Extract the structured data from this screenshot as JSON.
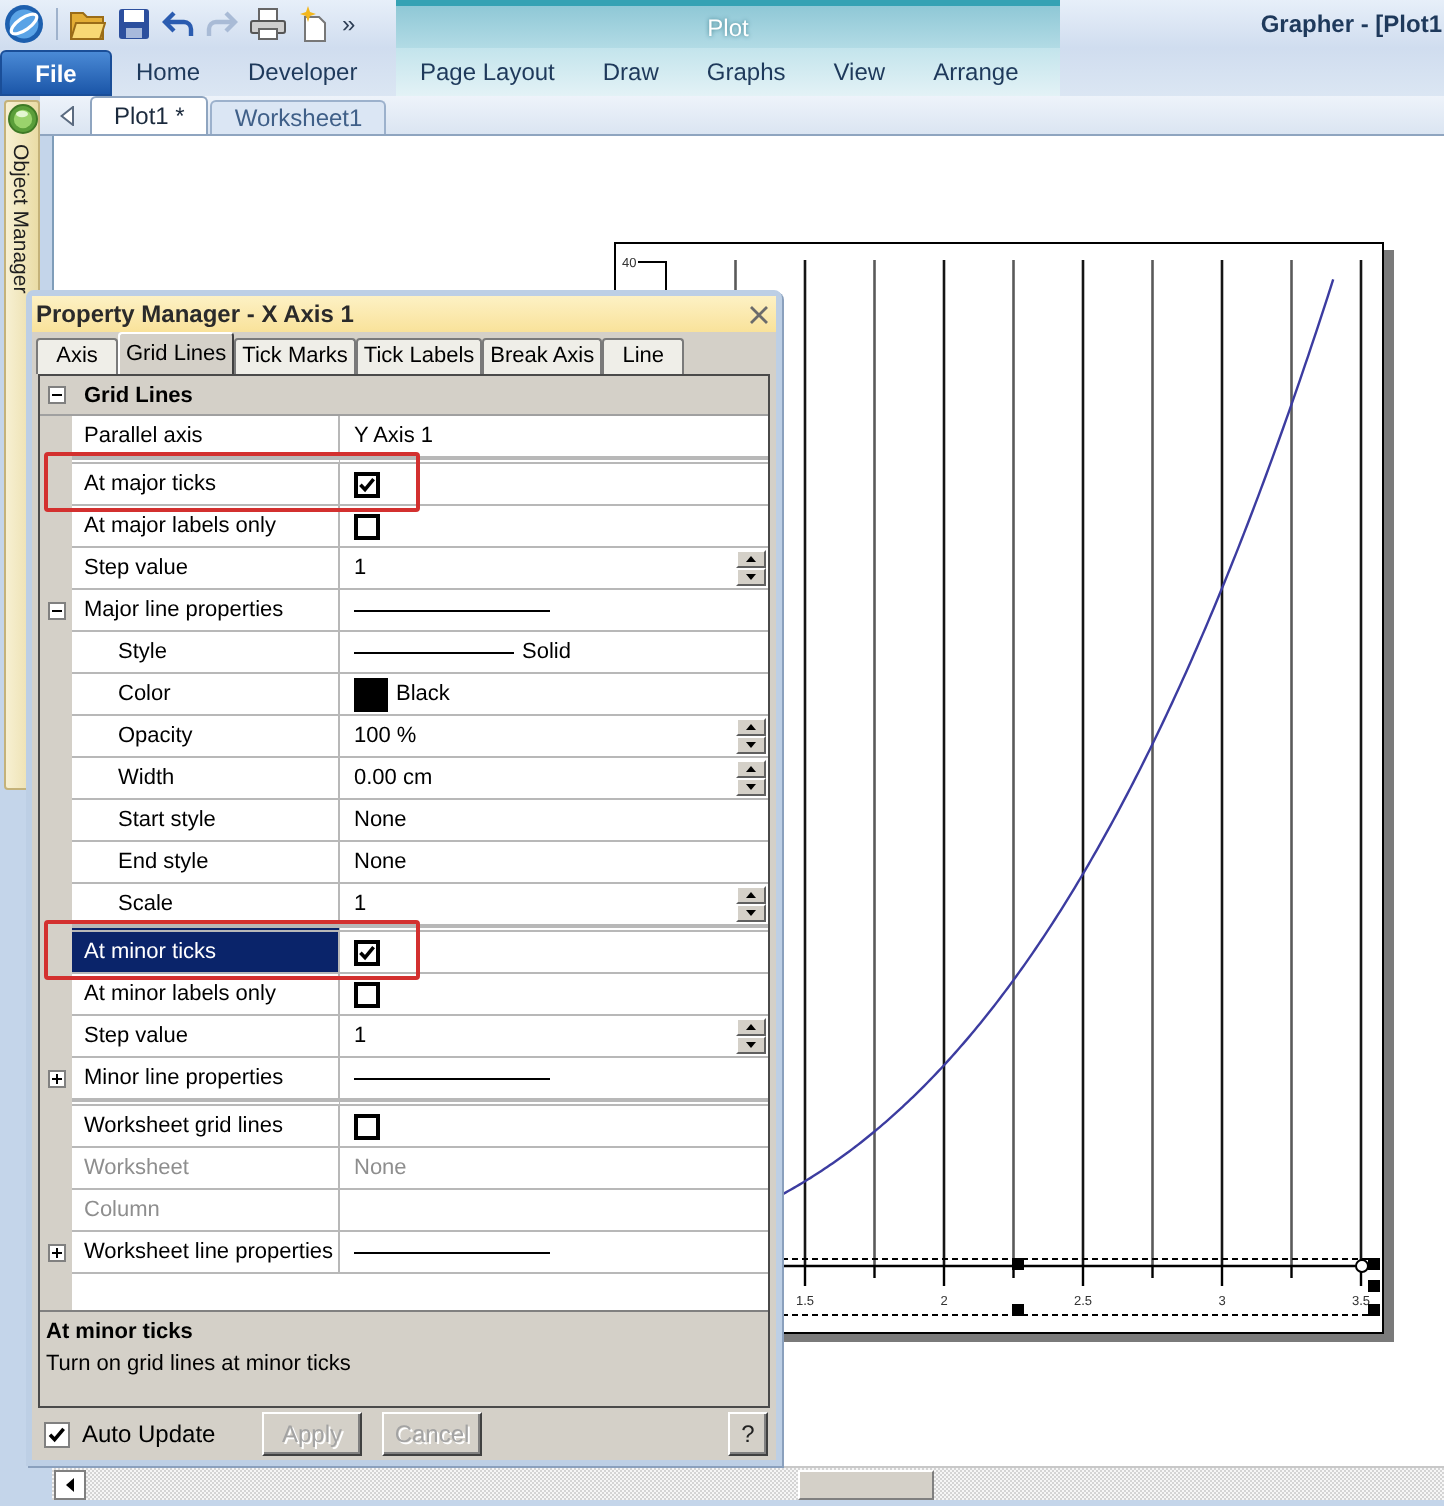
{
  "app": {
    "title": "Grapher - [Plot1",
    "quick_access_more": "»"
  },
  "ribbon": {
    "contextual_group": "Plot",
    "tabs": [
      {
        "label": "File",
        "kind": "file",
        "selected": false
      },
      {
        "label": "Home",
        "kind": "standard",
        "selected": false
      },
      {
        "label": "Developer",
        "kind": "standard",
        "selected": false
      },
      {
        "label": "Page Layout",
        "kind": "contextual",
        "selected": false
      },
      {
        "label": "Draw",
        "kind": "contextual",
        "selected": false
      },
      {
        "label": "Graphs",
        "kind": "contextual",
        "selected": false
      },
      {
        "label": "View",
        "kind": "contextual",
        "selected": false
      },
      {
        "label": "Arrange",
        "kind": "contextual",
        "selected": false
      }
    ]
  },
  "side_panel": {
    "label": "Object Manager"
  },
  "document_tabs": [
    {
      "label": "Plot1 *",
      "selected": true
    },
    {
      "label": "Worksheet1",
      "selected": false
    }
  ],
  "plot": {
    "y_axis": {
      "tick_labels": [
        "40"
      ]
    },
    "x_axis": {
      "selected": true,
      "tick_labels": [
        "1.5",
        "2",
        "2.5",
        "3",
        "3.5"
      ]
    }
  },
  "property_manager": {
    "title": "Property Manager - X Axis 1",
    "tabs": [
      {
        "label": "Axis",
        "selected": false
      },
      {
        "label": "Grid Lines",
        "selected": true
      },
      {
        "label": "Tick Marks",
        "selected": false
      },
      {
        "label": "Tick Labels",
        "selected": false
      },
      {
        "label": "Break Axis",
        "selected": false
      },
      {
        "label": "Line",
        "selected": false
      }
    ],
    "section": {
      "title": "Grid Lines",
      "expanded": true,
      "groups": [
        {
          "rows": [
            {
              "label": "Parallel axis",
              "kind": "text",
              "value": "Y Axis 1",
              "selected": false,
              "disabled": false,
              "annotated": false
            }
          ]
        },
        {
          "rows": [
            {
              "label": "At major ticks",
              "kind": "checkbox",
              "checked": true,
              "selected": false,
              "disabled": false,
              "annotated": true
            },
            {
              "label": "At major labels only",
              "kind": "checkbox",
              "checked": false,
              "selected": false,
              "disabled": false,
              "annotated": false
            },
            {
              "label": "Step value",
              "kind": "spin",
              "value": "1",
              "selected": false,
              "disabled": false,
              "annotated": false
            },
            {
              "label": "Major line properties",
              "kind": "line",
              "selected": false,
              "disabled": false,
              "annotated": false,
              "expanded": true,
              "children": [
                {
                  "label": "Style",
                  "kind": "line",
                  "value": "Solid",
                  "selected": false,
                  "disabled": false,
                  "annotated": false
                },
                {
                  "label": "Color",
                  "kind": "color",
                  "value": "Black",
                  "color": "#000000",
                  "selected": false,
                  "disabled": false,
                  "annotated": false
                },
                {
                  "label": "Opacity",
                  "kind": "spin",
                  "value": "100 %",
                  "selected": false,
                  "disabled": false,
                  "annotated": false
                },
                {
                  "label": "Width",
                  "kind": "spin",
                  "value": "0.00 cm",
                  "selected": false,
                  "disabled": false,
                  "annotated": false
                },
                {
                  "label": "Start style",
                  "kind": "text",
                  "value": "None",
                  "selected": false,
                  "disabled": false,
                  "annotated": false
                },
                {
                  "label": "End style",
                  "kind": "text",
                  "value": "None",
                  "selected": false,
                  "disabled": false,
                  "annotated": false
                },
                {
                  "label": "Scale",
                  "kind": "spin",
                  "value": "1",
                  "selected": false,
                  "disabled": false,
                  "annotated": false
                }
              ]
            }
          ]
        },
        {
          "rows": [
            {
              "label": "At minor ticks",
              "kind": "checkbox",
              "checked": true,
              "selected": true,
              "disabled": false,
              "annotated": true
            },
            {
              "label": "At minor labels only",
              "kind": "checkbox",
              "checked": false,
              "selected": false,
              "disabled": false,
              "annotated": false
            },
            {
              "label": "Step value",
              "kind": "spin",
              "value": "1",
              "selected": false,
              "disabled": false,
              "annotated": false
            },
            {
              "label": "Minor line properties",
              "kind": "line",
              "selected": false,
              "disabled": false,
              "annotated": false,
              "expanded": false
            }
          ]
        },
        {
          "rows": [
            {
              "label": "Worksheet grid lines",
              "kind": "checkbox",
              "checked": false,
              "selected": false,
              "disabled": false,
              "annotated": false
            },
            {
              "label": "Worksheet",
              "kind": "text",
              "value": "None",
              "selected": false,
              "disabled": true,
              "annotated": false
            },
            {
              "label": "Column",
              "kind": "text",
              "selected": false,
              "disabled": true,
              "annotated": false
            },
            {
              "label": "Worksheet line properties",
              "kind": "line",
              "selected": false,
              "disabled": false,
              "annotated": false,
              "expanded": false
            }
          ]
        }
      ]
    },
    "description": {
      "title": "At minor ticks",
      "text": "Turn on grid lines at minor ticks"
    },
    "auto_update": {
      "label": "Auto Update",
      "checked": true
    },
    "buttons": [
      {
        "label": "Apply",
        "kind": "action",
        "disabled": true
      },
      {
        "label": "Cancel",
        "kind": "action",
        "disabled": true
      },
      {
        "label": "?",
        "kind": "help",
        "disabled": false
      }
    ]
  }
}
